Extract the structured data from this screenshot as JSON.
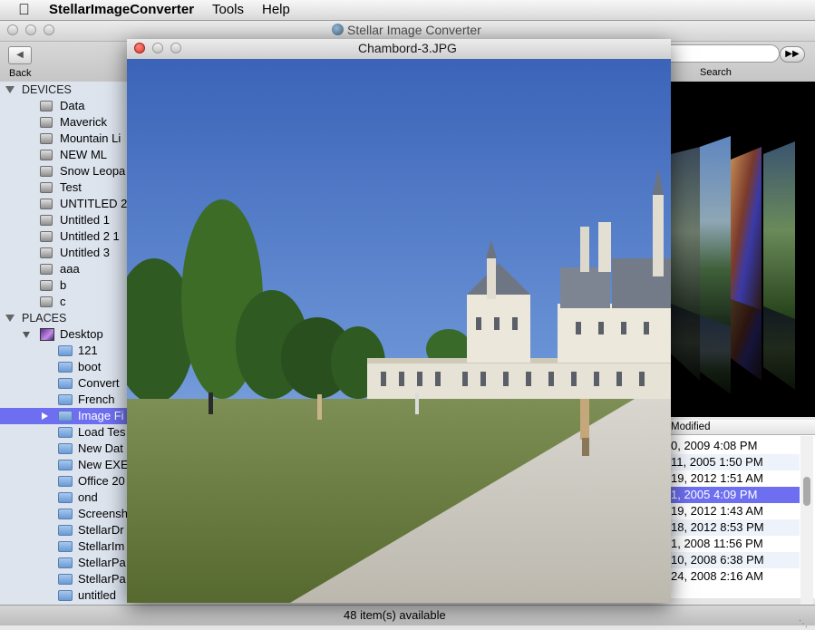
{
  "menubar": {
    "app_name": "StellarImageConverter",
    "menus": [
      "Tools",
      "Help"
    ]
  },
  "main_window": {
    "title": "Stellar Image Converter",
    "toolbar": {
      "back_label": "Back",
      "search_label": "Search",
      "search_value": ""
    }
  },
  "sidebar": {
    "devices_header": "DEVICES",
    "devices": [
      "Data",
      "Maverick",
      "Mountain Li",
      "NEW ML",
      "Snow Leopa",
      "Test",
      "UNTITLED 2",
      "Untitled 1",
      "Untitled 2 1",
      "Untitled 3",
      "aaa",
      "b",
      "c"
    ],
    "places_header": "PLACES",
    "desktop_label": "Desktop",
    "folders": [
      "121",
      "boot",
      "Convert",
      "French",
      "Image Fi",
      "Load Tes",
      "New Dat",
      "New EXE",
      "Office 20",
      "ond",
      "Screensh",
      "StellarDr",
      "StellarIm",
      "StellarPa",
      "StellarPa",
      "untitled"
    ],
    "selected_folder": "Image Fi"
  },
  "viewer": {
    "title": "Chambord-3.JPG"
  },
  "file_list": {
    "column_header": "Modified",
    "rows": [
      "0, 2009 4:08 PM",
      "11, 2005 1:50 PM",
      "19, 2012 1:51 AM",
      "1, 2005 4:09 PM",
      "19, 2012 1:43 AM",
      "18, 2012 8:53 PM",
      "1, 2008 11:56 PM",
      "10, 2008 6:38 PM",
      "24, 2008 2:16 AM"
    ],
    "selected_row": "1, 2005 4:09 PM"
  },
  "status": {
    "text": "48 item(s) available"
  },
  "colors": {
    "selection": "#6d6ff0",
    "sidebar_bg": "#dde4ee",
    "close_button": "#e0443e"
  }
}
